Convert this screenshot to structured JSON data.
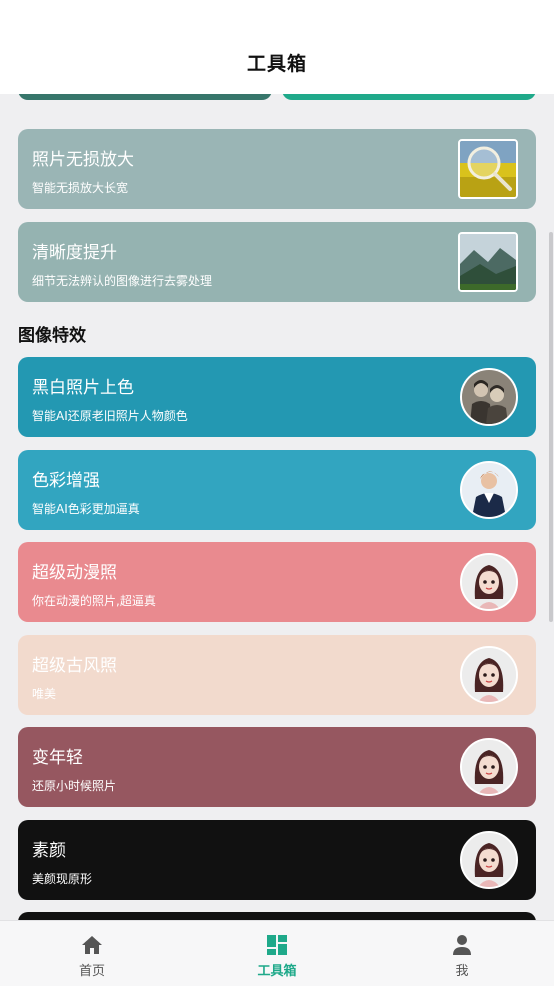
{
  "header": {
    "title": "工具箱"
  },
  "section": {
    "title": "图像特效"
  },
  "cards": [
    {
      "title": "照片无损放大",
      "subtitle": "智能无损放大长宽",
      "color": "#9ab5b5"
    },
    {
      "title": "清晰度提升",
      "subtitle": "细节无法辨认的图像进行去雾处理",
      "color": "#95b3b1"
    },
    {
      "title": "黑白照片上色",
      "subtitle": "智能AI还原老旧照片人物颜色",
      "color": "#2398b2"
    },
    {
      "title": "色彩增强",
      "subtitle": "智能AI色彩更加逼真",
      "color": "#32a5c0"
    },
    {
      "title": "超级动漫照",
      "subtitle": "你在动漫的照片,超逼真",
      "color": "#e98a8f"
    },
    {
      "title": "超级古风照",
      "subtitle": "唯美",
      "color": "#f2dacd"
    },
    {
      "title": "变年轻",
      "subtitle": "还原小时候照片",
      "color": "#965760"
    },
    {
      "title": "素颜",
      "subtitle": "美颜现原形",
      "color": "#111111"
    }
  ],
  "tabs": [
    {
      "label": "首页",
      "icon": "home-icon",
      "active": false
    },
    {
      "label": "工具箱",
      "icon": "dashboard-icon",
      "active": true
    },
    {
      "label": "我",
      "icon": "person-icon",
      "active": false
    }
  ],
  "colors": {
    "accent": "#1fa98a",
    "inactive": "#555555"
  }
}
